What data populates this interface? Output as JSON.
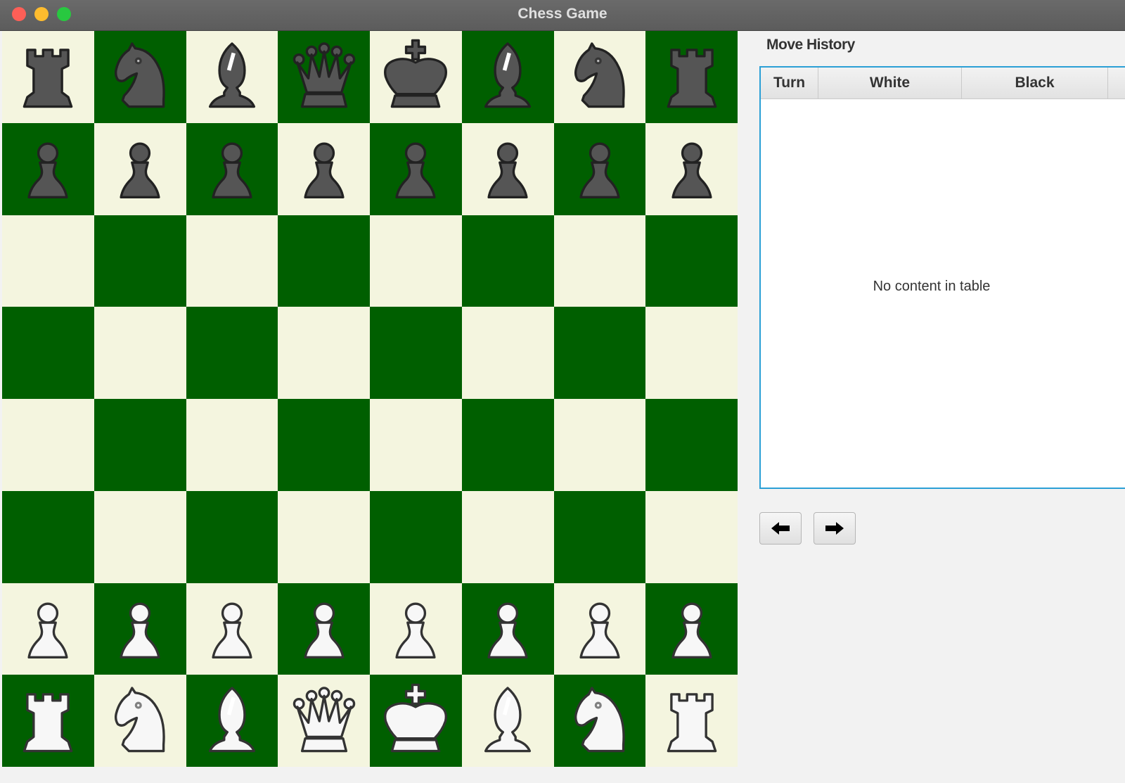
{
  "window": {
    "title": "Chess Game"
  },
  "board": {
    "light_color": "#f4f5df",
    "dark_color": "#005f00",
    "ranks": [
      [
        "r",
        "n",
        "b",
        "q",
        "k",
        "b",
        "n",
        "r"
      ],
      [
        "p",
        "p",
        "p",
        "p",
        "p",
        "p",
        "p",
        "p"
      ],
      [
        "",
        "",
        "",
        "",
        "",
        "",
        "",
        ""
      ],
      [
        "",
        "",
        "",
        "",
        "",
        "",
        "",
        ""
      ],
      [
        "",
        "",
        "",
        "",
        "",
        "",
        "",
        ""
      ],
      [
        "",
        "",
        "",
        "",
        "",
        "",
        "",
        ""
      ],
      [
        "P",
        "P",
        "P",
        "P",
        "P",
        "P",
        "P",
        "P"
      ],
      [
        "R",
        "N",
        "B",
        "Q",
        "K",
        "B",
        "N",
        "R"
      ]
    ]
  },
  "move_history": {
    "heading": "Move History",
    "columns": [
      "Turn",
      "White",
      "Black"
    ],
    "rows": [],
    "empty_text": "No content in table"
  },
  "navigation": {
    "back_icon": "arrow-left-icon",
    "forward_icon": "arrow-right-icon"
  }
}
